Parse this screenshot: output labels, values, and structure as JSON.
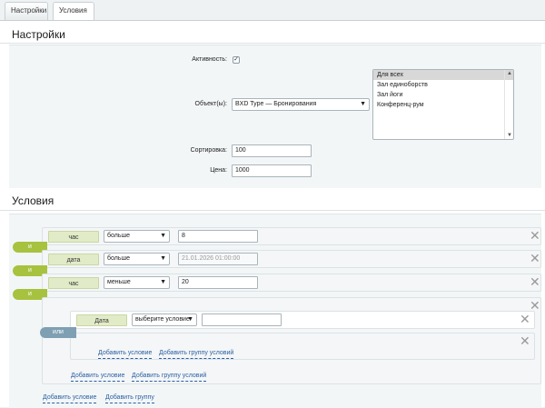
{
  "tabs": [
    {
      "label": "Настройки"
    },
    {
      "label": "Условия"
    }
  ],
  "settings": {
    "title": "Настройки",
    "active_label": "Активность:",
    "active_checked": true,
    "object_label": "Объект(ы):",
    "object_value": "BXD Type — Бронирования",
    "object_options": [
      "Для всех",
      "Зал единоборств",
      "Зал йоги",
      "Конференц-рум"
    ],
    "object_selected": "Для всех",
    "sort_label": "Сортировка:",
    "sort_value": "100",
    "price_label": "Цена:",
    "price_value": "1000"
  },
  "conditions": {
    "title": "Условия",
    "rows": [
      {
        "field": "час",
        "operator": "больше",
        "value": "8"
      },
      {
        "field": "дата",
        "operator": "больше",
        "value": "21.01.2026 01:00:00"
      },
      {
        "field": "час",
        "operator": "меньше",
        "value": "20"
      }
    ],
    "and_label": "и",
    "or_label": "или",
    "nested": {
      "field": "Дата",
      "operator_placeholder": "выберите условие",
      "value": ""
    },
    "links": {
      "add_condition": "Добавить условие",
      "add_group": "Добавить группу условий",
      "add_group_short": "Добавить группу"
    }
  },
  "icons": {
    "close": "close-icon",
    "dropdown": "chevron-down-icon",
    "check": "checkbox-checked-icon"
  },
  "colors": {
    "and_badge": "#a7c23f",
    "or_badge": "#7f9fb3",
    "field_tag": "#e2ebc8",
    "link": "#2a5fa3"
  }
}
